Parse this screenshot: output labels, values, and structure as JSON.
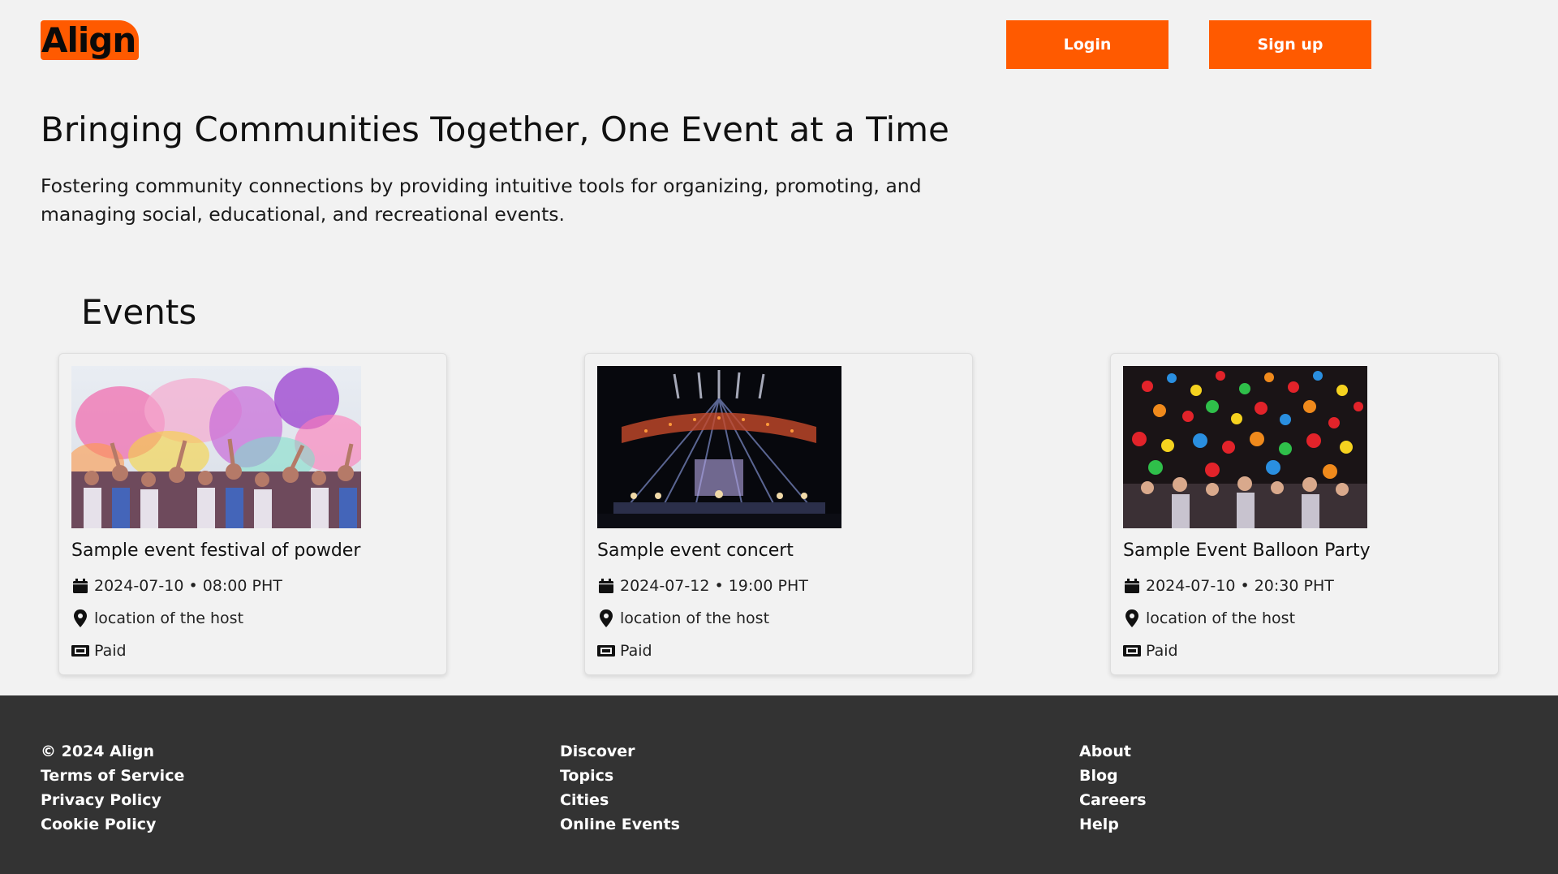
{
  "header": {
    "logo_text": "Align",
    "login_label": "Login",
    "signup_label": "Sign up",
    "accent_color": "#ff5a00"
  },
  "hero": {
    "title": "Bringing Communities Together, One Event at a Time",
    "subtitle": "Fostering community connections by providing intuitive tools for organizing, promoting, and managing social, educational, and recreational events."
  },
  "events": {
    "heading": "Events",
    "items": [
      {
        "title": "Sample event festival of powder",
        "date": "2024-07-10 • 08:00 PHT",
        "location": "location of the host",
        "price": "Paid",
        "image": "color-powder-festival-photo"
      },
      {
        "title": "Sample event concert",
        "date": "2024-07-12 • 19:00 PHT",
        "location": "location of the host",
        "price": "Paid",
        "image": "concert-stage-lights-photo"
      },
      {
        "title": "Sample Event Balloon Party",
        "date": "2024-07-10 • 20:30 PHT",
        "location": "location of the host",
        "price": "Paid",
        "image": "balloon-party-photo"
      }
    ],
    "icons": {
      "date": "calendar-icon",
      "location": "map-pin-icon",
      "price": "ticket-icon"
    }
  },
  "footer": {
    "background_color": "#333333",
    "col1": [
      "© 2024 Align",
      "Terms of Service",
      "Privacy Policy",
      "Cookie Policy"
    ],
    "col2": [
      "Discover",
      "Topics",
      "Cities",
      "Online Events"
    ],
    "col3": [
      "About",
      "Blog",
      "Careers",
      "Help"
    ]
  }
}
